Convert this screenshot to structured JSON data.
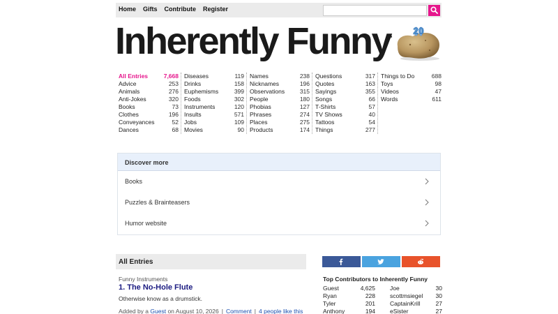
{
  "nav": [
    "Home",
    "Gifts",
    "Contribute",
    "Register"
  ],
  "search": {
    "value": "",
    "placeholder": ""
  },
  "logo": {
    "text": "Inherently Funny",
    "tm": "™",
    "badge": "20"
  },
  "categories": [
    [
      [
        "All Entries",
        "7,668"
      ],
      [
        "Advice",
        "253"
      ],
      [
        "Animals",
        "276"
      ],
      [
        "Anti-Jokes",
        "320"
      ],
      [
        "Books",
        "73"
      ],
      [
        "Clothes",
        "196"
      ],
      [
        "Conveyances",
        "52"
      ],
      [
        "Dances",
        "68"
      ]
    ],
    [
      [
        "Diseases",
        "119"
      ],
      [
        "Drinks",
        "158"
      ],
      [
        "Euphemisms",
        "399"
      ],
      [
        "Foods",
        "302"
      ],
      [
        "Instruments",
        "120"
      ],
      [
        "Insults",
        "571"
      ],
      [
        "Jobs",
        "109"
      ],
      [
        "Movies",
        "90"
      ]
    ],
    [
      [
        "Names",
        "238"
      ],
      [
        "Nicknames",
        "196"
      ],
      [
        "Observations",
        "315"
      ],
      [
        "People",
        "180"
      ],
      [
        "Phobias",
        "127"
      ],
      [
        "Phrases",
        "274"
      ],
      [
        "Places",
        "275"
      ],
      [
        "Products",
        "174"
      ]
    ],
    [
      [
        "Questions",
        "317"
      ],
      [
        "Quotes",
        "163"
      ],
      [
        "Sayings",
        "355"
      ],
      [
        "Songs",
        "66"
      ],
      [
        "T-Shirts",
        "57"
      ],
      [
        "TV Shows",
        "40"
      ],
      [
        "Tattoos",
        "54"
      ],
      [
        "Things",
        "277"
      ]
    ],
    [
      [
        "Things to Do",
        "688"
      ],
      [
        "Toys",
        "98"
      ],
      [
        "Videos",
        "47"
      ],
      [
        "Words",
        "611"
      ]
    ]
  ],
  "discover": {
    "title": "Discover more",
    "items": [
      "Books",
      "Puzzles & Brainteasers",
      "Humor website"
    ]
  },
  "entries": {
    "heading": "All Entries",
    "category": "Funny Instruments",
    "title": "1. The No-Hole Flute",
    "body": "Otherwise know as a drumstick.",
    "meta_prefix": "Added by a",
    "author": "Guest",
    "meta_date": "on August 10, 2026",
    "comment": "Comment",
    "likes": "4 people like this"
  },
  "share": [
    {
      "icon": "facebook-icon",
      "color": "#3b5998"
    },
    {
      "icon": "twitter-icon",
      "color": "#4aa3df"
    },
    {
      "icon": "reddit-icon",
      "color": "#e8532b"
    }
  ],
  "contributors": {
    "title": "Top Contributors to Inherently Funny",
    "left": [
      [
        "Guest",
        "4,625"
      ],
      [
        "Ryan",
        "228"
      ],
      [
        "Tyler",
        "201"
      ],
      [
        "Anthony",
        "194"
      ]
    ],
    "right": [
      [
        "Joe",
        "30"
      ],
      [
        "scottmsiegel",
        "30"
      ],
      [
        "CaptainKrill",
        "27"
      ],
      [
        "eSister",
        "27"
      ]
    ]
  },
  "colors": {
    "accent": "#e6168c",
    "discover_header": "#e8f0fb",
    "link": "#1a4fb0"
  }
}
